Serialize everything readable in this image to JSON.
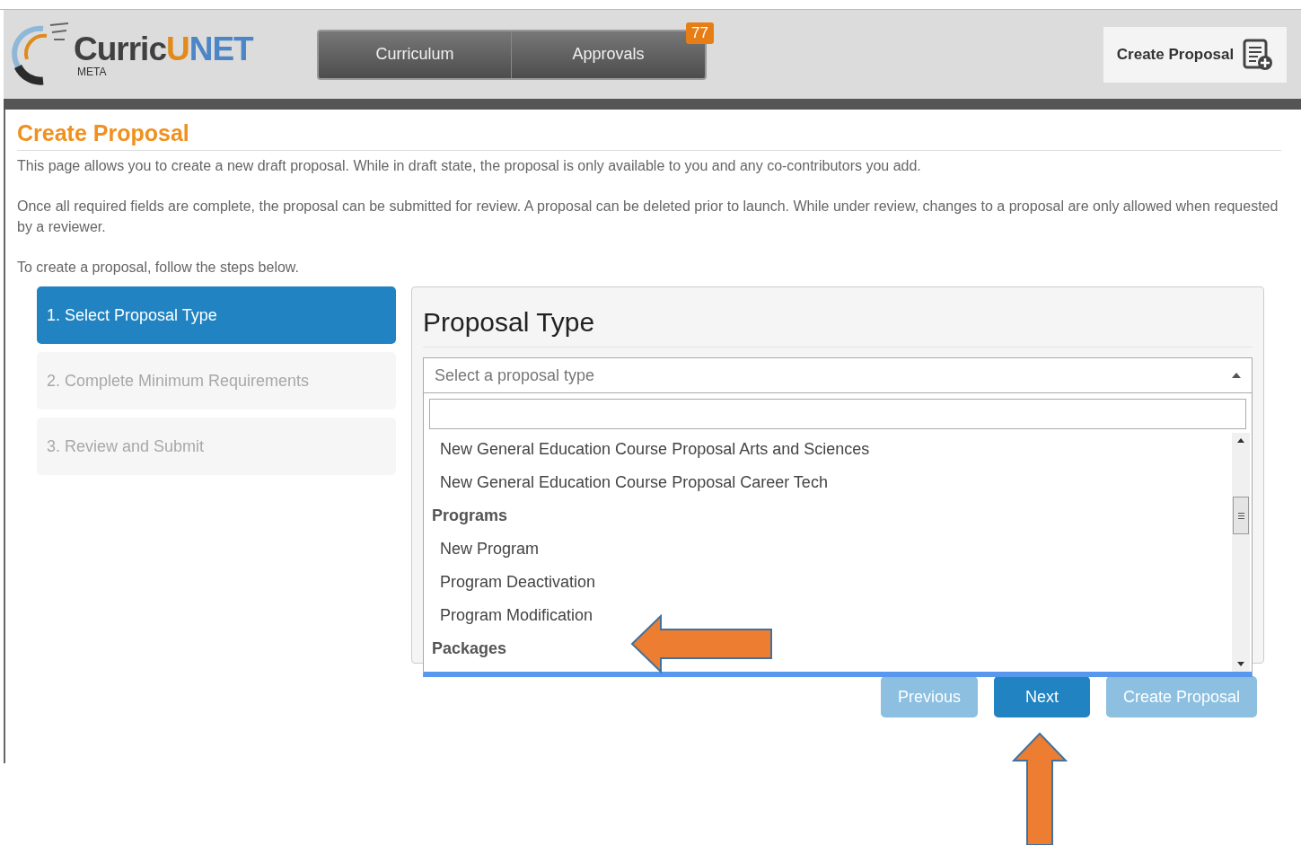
{
  "header": {
    "logo": {
      "name": [
        "Curric",
        "U",
        "NET"
      ],
      "sub": "META"
    },
    "nav": [
      {
        "label": "Curriculum"
      },
      {
        "label": "Approvals",
        "badge": "77"
      }
    ],
    "create_button": "Create Proposal"
  },
  "page": {
    "title": "Create Proposal",
    "paragraphs": [
      "This page allows you to create a new draft proposal. While in draft state, the proposal is only available to you and any co-contributors you add.",
      "Once all required fields are complete, the proposal can be submitted for review. A proposal can be deleted prior to launch. While under review, changes to a proposal are only allowed when requested by a reviewer.",
      "To create a proposal, follow the steps below."
    ]
  },
  "steps": [
    {
      "label": "1. Select Proposal Type",
      "selected": true
    },
    {
      "label": "2. Complete Minimum Requirements",
      "selected": false
    },
    {
      "label": "3. Review and Submit",
      "selected": false
    }
  ],
  "panel": {
    "title": "Proposal Type",
    "select": {
      "placeholder": "Select a proposal type",
      "expanded": true
    },
    "options": [
      {
        "kind": "option",
        "label": "New General Education Course Proposal Arts and Sciences"
      },
      {
        "kind": "option",
        "label": "New General Education Course Proposal Career Tech"
      },
      {
        "kind": "group",
        "label": "Programs"
      },
      {
        "kind": "option",
        "label": "New Program"
      },
      {
        "kind": "option",
        "label": "Program Deactivation"
      },
      {
        "kind": "option",
        "label": "Program Modification"
      },
      {
        "kind": "group",
        "label": "Packages"
      }
    ]
  },
  "buttons": [
    {
      "label": "Previous",
      "disabled": true
    },
    {
      "label": "Next",
      "disabled": false
    },
    {
      "label": "Create Proposal",
      "disabled": true
    }
  ]
}
